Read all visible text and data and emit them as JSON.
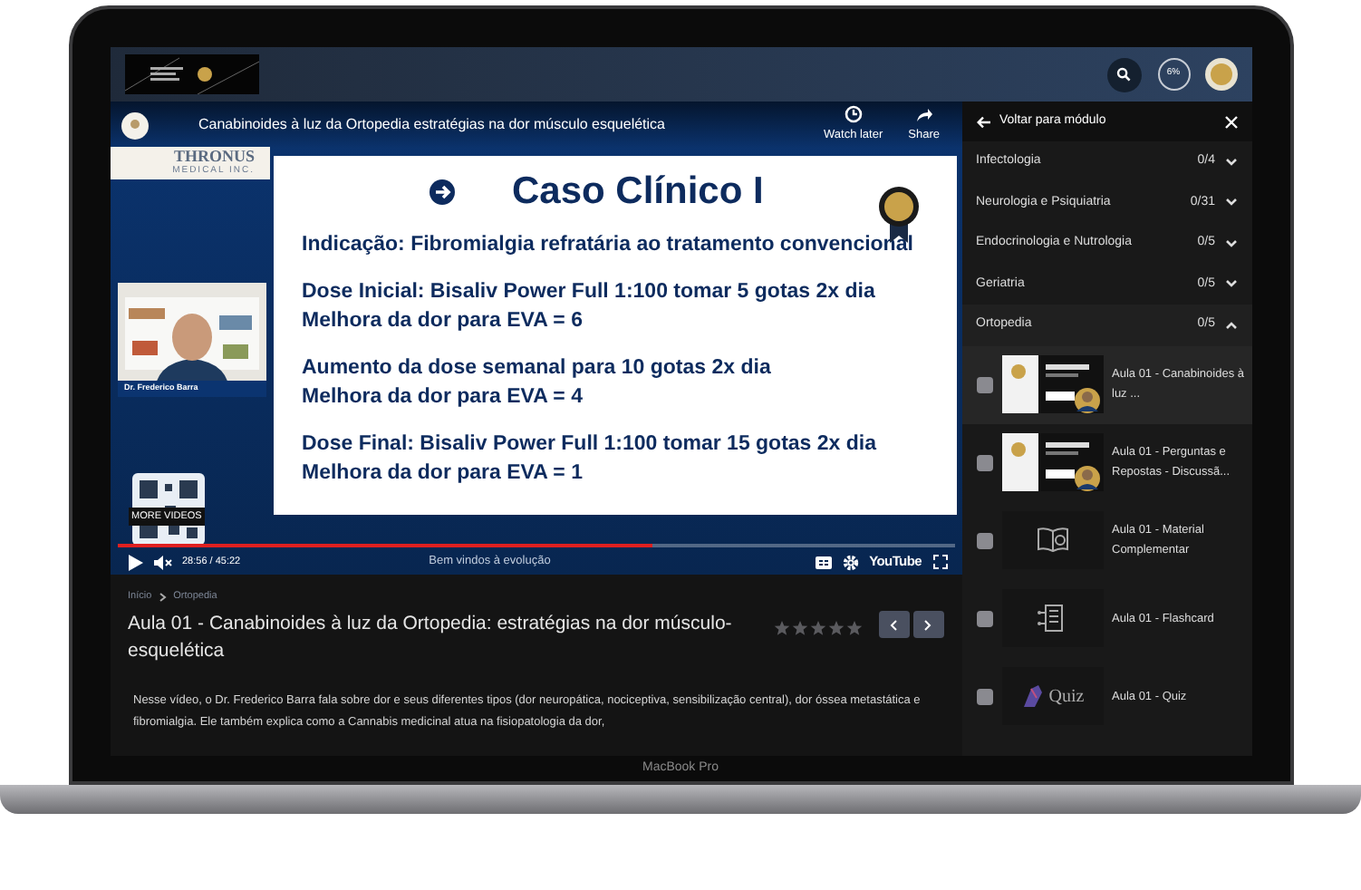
{
  "top_bar": {
    "progress": "6%"
  },
  "video": {
    "title": "Canabinoides à luz da Ortopedia estratégias na dor músculo esquelética",
    "actions": [
      {
        "kind": "clock",
        "label": "Watch later"
      },
      {
        "kind": "share",
        "label": "Share"
      }
    ],
    "brand": {
      "name": "THRONUS",
      "sub": "MEDICAL INC."
    },
    "slide": {
      "heading": "Caso Clínico I",
      "paragraphs": [
        [
          "Indicação: Fibromialgia refratária ao tratamento convencional"
        ],
        [
          "Dose Inicial: Bisaliv Power Full 1:100 tomar 5 gotas 2x dia",
          "Melhora da dor para EVA = 6"
        ],
        [
          "Aumento da dose semanal para 10 gotas 2x dia",
          "Melhora da dor para EVA = 4"
        ],
        [
          "Dose Final: Bisaliv Power Full 1:100 tomar 15 gotas 2x dia",
          "Melhora da dor para EVA = 1"
        ]
      ]
    },
    "speaker": "Dr. Frederico Barra",
    "overlay": "MORE VIDEOS",
    "level": 0.64,
    "time": "28:56 / 45:22",
    "caption": "Bem vindos à evolução",
    "platform": "YouTube"
  },
  "breadcrumb": [
    "Início",
    "Ortopedia"
  ],
  "lesson_title": "Aula 01 - Canabinoides à luz da Ortopedia: estratégias na dor músculo-esquelética",
  "stars": 0,
  "description": "Nesse vídeo, o Dr. Frederico Barra fala sobre dor e seus diferentes tipos (dor neuropática, nociceptiva, sensibilização central), dor óssea metastática e fibromialgia. Ele também explica como a Cannabis medicinal atua na fisiopatologia da dor,",
  "sidebar": {
    "back": "Voltar para módulo",
    "modules": [
      {
        "name": "Infectologia",
        "count": "0/4",
        "expanded": false
      },
      {
        "name": "Neurologia e Psiquiatria",
        "count": "0/31",
        "expanded": false
      },
      {
        "name": "Endocrinologia e Nutrologia",
        "count": "0/5",
        "expanded": false
      },
      {
        "name": "Geriatria",
        "count": "0/5",
        "expanded": false
      },
      {
        "name": "Ortopedia",
        "count": "0/5",
        "expanded": true
      }
    ],
    "lessons": [
      {
        "title": "Aula 01 - Canabinoides à luz ...",
        "checked": false,
        "thumb": {
          "kind": "video"
        }
      },
      {
        "title": "Aula 01 - Perguntas e Repostas - Discussã...",
        "checked": false,
        "thumb": {
          "kind": "video"
        }
      },
      {
        "title": "Aula 01 - Material Complementar",
        "checked": false,
        "thumb": {
          "kind": "book"
        }
      },
      {
        "title": "Aula 01 - Flashcard",
        "checked": false,
        "thumb": {
          "kind": "document"
        }
      },
      {
        "title": "Aula 01 - Quiz",
        "checked": false,
        "thumb": {
          "kind": "quiz",
          "label": "Quiz"
        }
      }
    ]
  },
  "device_label": "MacBook Pro"
}
